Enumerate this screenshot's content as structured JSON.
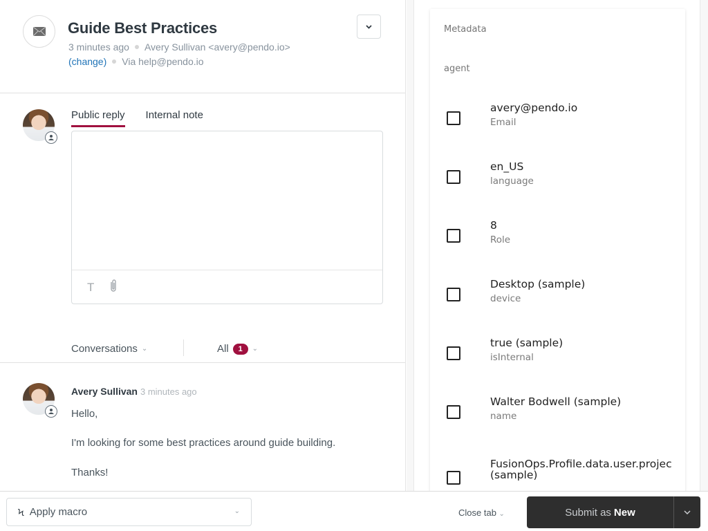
{
  "ticket": {
    "icon": "envelope-icon",
    "title": "Guide Best Practices",
    "time_ago": "3 minutes ago",
    "requester": "Avery Sullivan <avery@pendo.io>",
    "change_link": "(change)",
    "via": "Via help@pendo.io",
    "options_icon": "chevron-down-icon"
  },
  "composer": {
    "tabs": [
      {
        "label": "Public reply",
        "active": true
      },
      {
        "label": "Internal note",
        "active": false
      }
    ],
    "reply_value": "",
    "tools": {
      "text_icon": "T",
      "attach_icon": "paperclip-icon"
    }
  },
  "conversations": {
    "filter_label": "Conversations",
    "scope_label": "All",
    "count": "1"
  },
  "message": {
    "author": "Avery Sullivan",
    "time": "3 minutes ago",
    "lines": [
      "Hello,",
      "I'm looking for some best practices around guide building.",
      "Thanks!"
    ]
  },
  "metadata": {
    "title": "Metadata",
    "section": "agent",
    "items": [
      {
        "value": "avery@pendo.io",
        "key": "Email",
        "checked": false
      },
      {
        "value": "en_US",
        "key": "language",
        "checked": false
      },
      {
        "value": "8",
        "key": "Role",
        "checked": false
      },
      {
        "value": "Desktop (sample)",
        "key": "device",
        "checked": false
      },
      {
        "value": "true (sample)",
        "key": "isInternal",
        "checked": false
      },
      {
        "value": "Walter Bodwell (sample)",
        "key": "name",
        "checked": false
      },
      {
        "value": "FusionOps.Profile.data.user.projec",
        "value2": "(sample)",
        "key": "",
        "checked": false
      }
    ]
  },
  "footer": {
    "macro_label": "Apply macro",
    "close_tab_label": "Close tab",
    "submit_prefix": "Submit as",
    "submit_status": "New"
  },
  "colors": {
    "accent": "#a0103f",
    "link": "#1f73b7",
    "submit_bg": "#2e2e2e"
  }
}
